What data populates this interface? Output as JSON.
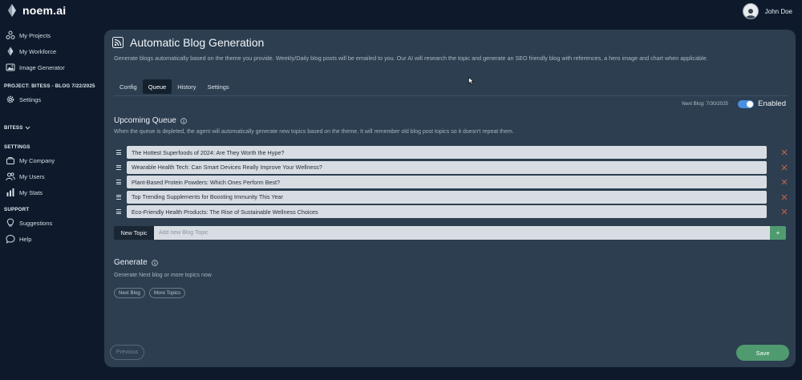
{
  "app": {
    "brand": "noem.ai",
    "user_name": "John Doe"
  },
  "sidebar": {
    "top_items": [
      {
        "label": "My Projects",
        "icon": "projects-icon"
      },
      {
        "label": "My Workforce",
        "icon": "workforce-icon"
      },
      {
        "label": "Image Generator",
        "icon": "image-icon"
      }
    ],
    "project_heading": "PROJECT: BITESS - BLOG 7/22/2025",
    "project_settings": "Settings",
    "company_selector": "BITESS",
    "settings_heading": "SETTINGS",
    "settings_items": [
      {
        "label": "My Company",
        "icon": "company-icon"
      },
      {
        "label": "My Users",
        "icon": "users-icon"
      },
      {
        "label": "My Stats",
        "icon": "stats-icon"
      }
    ],
    "support_heading": "SUPPORT",
    "support_items": [
      {
        "label": "Suggestions",
        "icon": "lightbulb-icon"
      },
      {
        "label": "Help",
        "icon": "chat-icon"
      }
    ]
  },
  "page": {
    "title": "Automatic Blog Generation",
    "description": "Generate blogs automatically based on the theme you provide. Weekly/Daily blog posts will be emailed to you. Our AI will research the topic and generate an SEO friendly blog with references, a hero image and chart when applicable.",
    "tabs": [
      {
        "label": "Config",
        "active": false
      },
      {
        "label": "Queue",
        "active": true
      },
      {
        "label": "History",
        "active": false
      },
      {
        "label": "Settings",
        "active": false
      }
    ],
    "next_blog": "Next Blog: 7/30/2025",
    "enabled_label": "Enabled",
    "enabled": true
  },
  "queue": {
    "title": "Upcoming Queue",
    "description": "When the queue is depleted, the agent will automatically generate new topics based on the theme. It will remember old blog post topics so it doesn't repeat them.",
    "items": [
      "The Hottest Superfoods of 2024: Are They Worth the Hype?",
      "Wearable Health Tech: Can Smart Devices Really Improve Your Wellness?",
      "Plant-Based Protein Powders: Which Ones Perform Best?",
      "Top Trending Supplements for Boosting Immunity This Year",
      "Eco-Friendly Health Products: The Rise of Sustainable Wellness Choices"
    ],
    "new_topic_label": "New Topic",
    "new_topic_placeholder": "Add new Blog Topic",
    "add_label": "+"
  },
  "generate": {
    "title": "Generate",
    "description": "Generate Next blog or more topics now",
    "next_blog_button": "Next Blog",
    "more_topics_button": "More Topics"
  },
  "footer": {
    "previous_label": "Previous",
    "save_label": "Save"
  },
  "colors": {
    "background": "#0e1a2b",
    "panel": "#2c3e50",
    "accent_green": "#4f9b6f",
    "toggle_blue": "#4a8fe0",
    "remove_x": "#c0634f"
  }
}
